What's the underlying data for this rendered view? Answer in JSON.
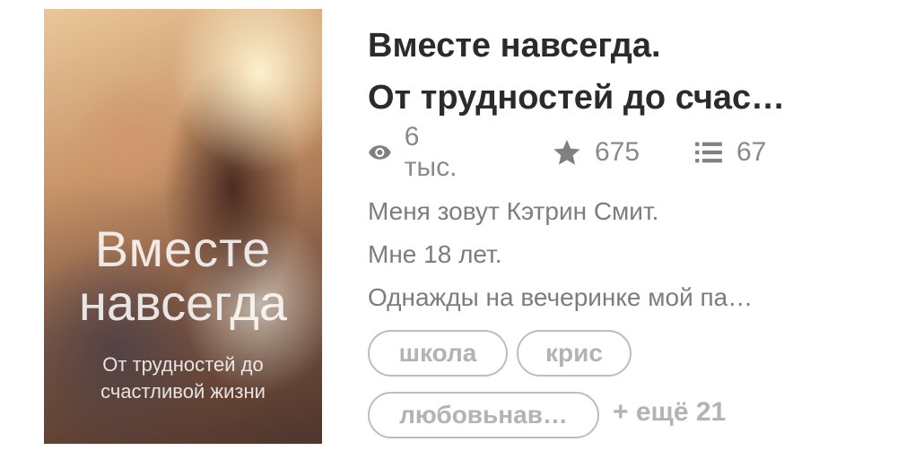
{
  "book": {
    "cover": {
      "title_line1": "Вместе",
      "title_line2": "навсегда",
      "subtitle_line1": "От трудностей до",
      "subtitle_line2": "счастливой жизни"
    },
    "title_line1": "Вместе навсегда.",
    "title_line2": "От трудностей до счас…",
    "stats": {
      "views_icon": "eye-icon",
      "views": "6 тыс.",
      "rating_icon": "star-icon",
      "rating": "675",
      "chapters_icon": "list-icon",
      "chapters": "67"
    },
    "description": [
      "Меня зовут Кэтрин Смит.",
      "Мне 18 лет.",
      "Однажды на вечеринке мой па…"
    ],
    "tags": [
      "школа",
      "крис",
      "любовьнав…"
    ],
    "more_tags": "+ ещё 21"
  }
}
